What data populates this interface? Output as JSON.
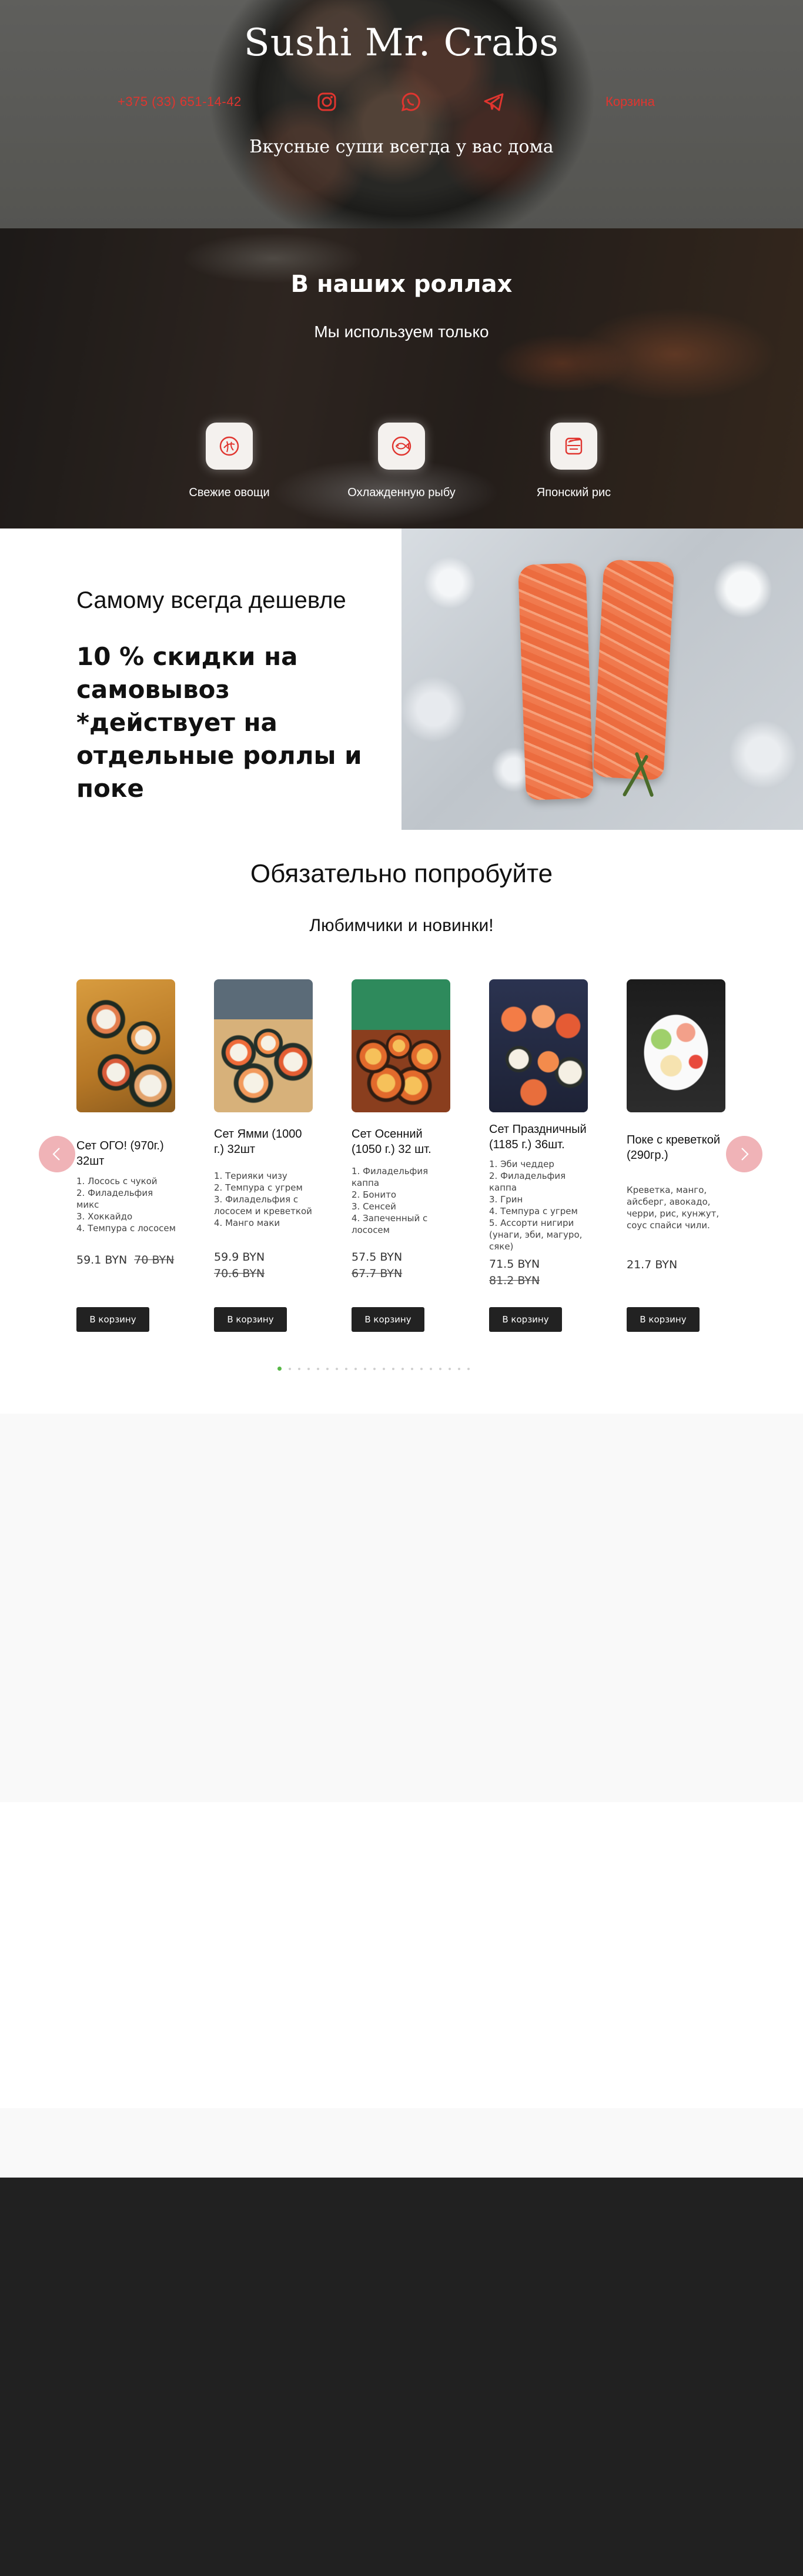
{
  "hero": {
    "title": "Sushi  Mr. Crabs",
    "phone": "+375 (33) 651-14-42",
    "social_icons": [
      "instagram-icon",
      "whatsapp-icon",
      "telegram-icon"
    ],
    "cart_label": "Корзина",
    "tagline": "Вкусные суши всегда у вас дома",
    "accent_color": "#e0352f"
  },
  "rolls": {
    "title": "В наших роллах",
    "subtitle": "Мы используем только",
    "features": [
      {
        "icon": "vegetables-icon",
        "label": "Свежие овощи"
      },
      {
        "icon": "fish-icon",
        "label": "Охлажденную рыбу"
      },
      {
        "icon": "rice-bowl-icon",
        "label": "Японский рис"
      }
    ]
  },
  "promo": {
    "title": "Самому всегда дешевле",
    "text": "10 % скидки на самовывоз\n*действует на отдельные роллы и поке"
  },
  "try": {
    "title": "Обязательно попробуйте",
    "subtitle": "Любимчики и новинки!",
    "button_label": "В корзину",
    "products": [
      {
        "name": "Сет ОГО! (970г.) 32шт",
        "desc": "1. Лосось с чукой\n2. Филадельфия микс\n3. Хоккайдо\n4. Темпура с лососем",
        "price": "59.1 BYN",
        "old_price": "70 BYN"
      },
      {
        "name": "Сет Ямми (1000 г.) 32шт",
        "desc": "1. Терияки чизу\n2. Темпура с угрем\n3. Филадельфия с лососем и креветкой\n4. Манго маки",
        "price": "59.9 BYN",
        "old_price": "70.6 BYN"
      },
      {
        "name": "Сет Осенний (1050 г.) 32 шт.",
        "desc": "1. Филадельфия каппа\n2. Бонито\n3. Сенсей\n4. Запеченный с лососем",
        "price": "57.5 BYN",
        "old_price": "67.7 BYN"
      },
      {
        "name": "Сет Праздничный (1185 г.) 36шт.",
        "desc": "1. Эби чеддер\n2. Филадельфия каппа\n3. Грин\n4. Темпура с угрем\n5. Ассорти нигири (унаги, эби, магуро, сяке)",
        "price": "71.5 BYN",
        "old_price": "81.2 BYN"
      },
      {
        "name": "Поке с креветкой (290гр.)",
        "desc": "Креветка, манго, айсберг, авокадо, черри, рис, кунжут, соус спайси чили.",
        "price": "21.7 BYN",
        "old_price": ""
      }
    ],
    "carousel_dots": 21,
    "active_dot": 0,
    "arrow_color": "#f0b3b7",
    "dot_active_color": "#57b847"
  }
}
